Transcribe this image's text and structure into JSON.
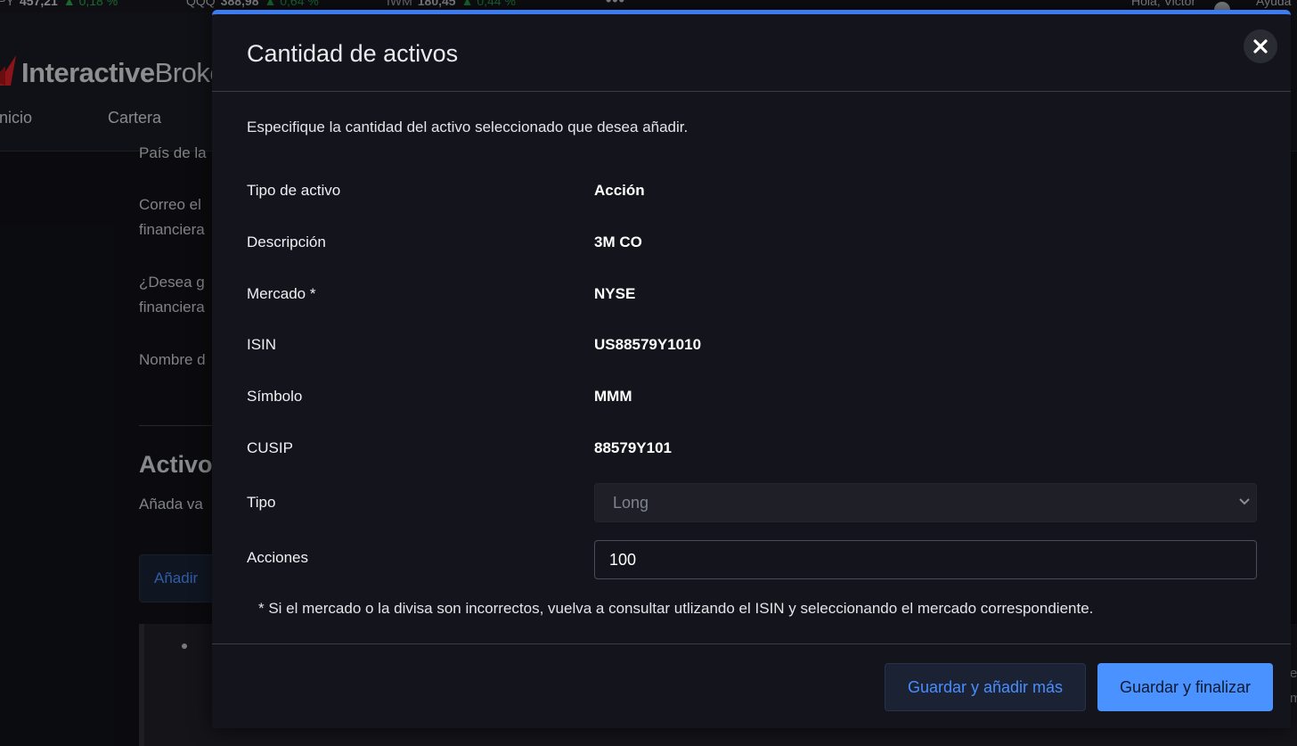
{
  "ticker": {
    "items": [
      {
        "symbol": "SPY",
        "price": "457,21",
        "change": "▲ 0,18 %"
      },
      {
        "symbol": "QQQ",
        "price": "388,98",
        "change": "▲ 0,64 %"
      },
      {
        "symbol": "IWM",
        "price": "180,45",
        "change": "▲ 0,44 %"
      }
    ],
    "more": "•••",
    "greeting": "Hola, Victor",
    "help": "Ayuda"
  },
  "brand": {
    "name_bold": "Interactive",
    "name_regular": "Brokers"
  },
  "nav": {
    "items": [
      "Inicio",
      "Cartera"
    ]
  },
  "background": {
    "country_label": "País de la",
    "email_label_1": "Correo el",
    "email_label_2": "financiera",
    "question_label_1": "¿Desea g",
    "question_label_2": "financiera",
    "name_label": "Nombre d",
    "section_heading": "Activo",
    "section_sub": "Añada va",
    "add_button": "Añadir",
    "edge_text_1": "e",
    "edge_text_2": "m"
  },
  "modal": {
    "title": "Cantidad de activos",
    "intro": "Especifique la cantidad del activo seleccionado que desea añadir.",
    "fields": [
      {
        "label": "Tipo de activo",
        "value": "Acción"
      },
      {
        "label": "Descripción",
        "value": "3M CO"
      },
      {
        "label": "Mercado *",
        "value": "NYSE"
      },
      {
        "label": "ISIN",
        "value": "US88579Y1010"
      },
      {
        "label": "Símbolo",
        "value": "MMM"
      },
      {
        "label": "CUSIP",
        "value": "88579Y101"
      }
    ],
    "type_label": "Tipo",
    "type_value": "Long",
    "shares_label": "Acciones",
    "shares_value": "100",
    "footnote": "* Si el mercado o la divisa son incorrectos, vuelva a consultar utlizando el ISIN y seleccionando el mercado correspondiente.",
    "save_more_button": "Guardar y añadir más",
    "save_finish_button": "Guardar y finalizar"
  },
  "colors": {
    "accent": "#3d7cf0",
    "primary_button": "#4a92ff",
    "positive": "#27a148",
    "modal_bg": "#14151c"
  }
}
